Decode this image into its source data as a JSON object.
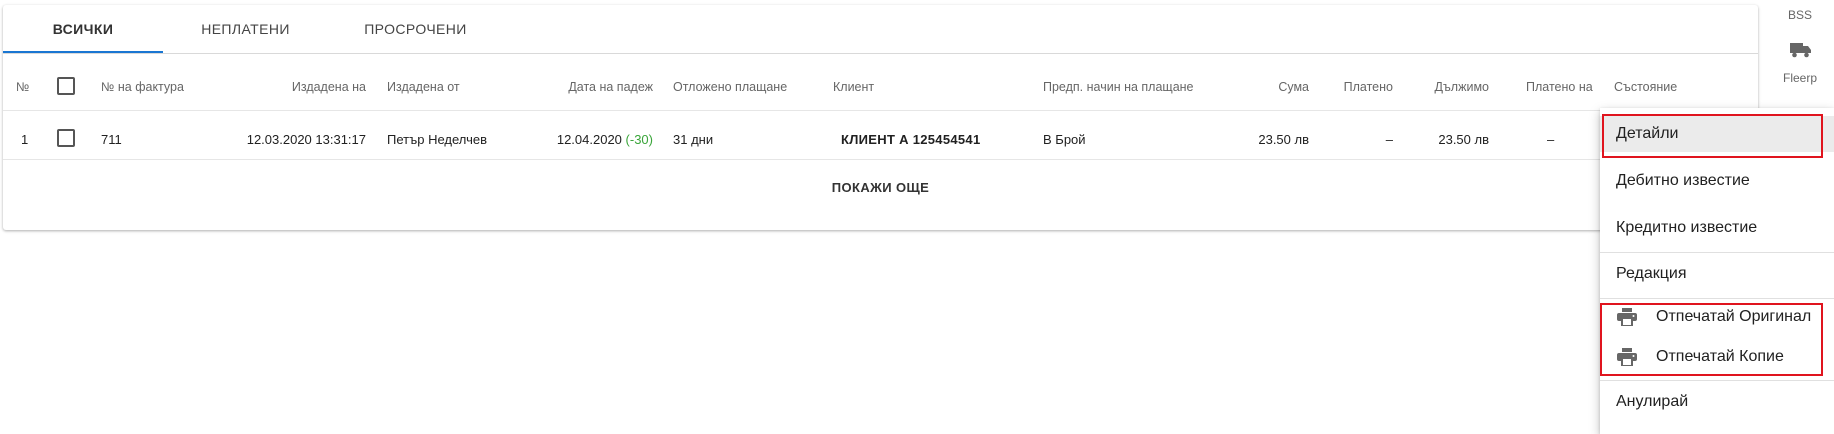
{
  "tabs": [
    {
      "label": "ВСИЧКИ",
      "active": true
    },
    {
      "label": "НЕПЛАТЕНИ",
      "active": false
    },
    {
      "label": "ПРОСРОЧЕНИ",
      "active": false
    }
  ],
  "table": {
    "headers": {
      "num": "№",
      "invoice_no": "№ на фактура",
      "issued_on": "Издадена на",
      "issued_by": "Издадена от",
      "due_date": "Дата на падеж",
      "deferred": "Отложено плащане",
      "client": "Клиент",
      "payment_method": "Предп. начин на плащане",
      "amount": "Сума",
      "paid": "Платено",
      "owed": "Дължимо",
      "paid_on": "Платено на",
      "status": "Състояние"
    },
    "rows": [
      {
        "num": "1",
        "invoice_no": "711",
        "issued_on": "12.03.2020 13:31:17",
        "issued_by": "Петър Неделчев",
        "due_date": "12.04.2020",
        "due_offset": "(-30)",
        "deferred": "31 дни",
        "client": "КЛИЕНТ А 125454541",
        "payment_method": "В Брой",
        "amount": "23.50 лв",
        "paid": "–",
        "owed": "23.50 лв",
        "paid_on": "–"
      }
    ],
    "show_more": "ПОКАЖИ ОЩЕ"
  },
  "rail": {
    "top_label": "BSS",
    "item_label": "Fleerp",
    "item_icon": "truck-icon"
  },
  "context_menu": {
    "items": [
      {
        "label": "Детайли",
        "highlighted": true
      },
      {
        "label": "Дебитно известие"
      },
      {
        "label": "Кредитно известие"
      },
      {
        "label": "Редакция"
      },
      {
        "label": "Отпечатай Оригинал",
        "icon": "print-icon"
      },
      {
        "label": "Отпечатай Копие",
        "icon": "print-icon"
      },
      {
        "label": "Анулирай"
      }
    ]
  },
  "colors": {
    "accent": "#1976d2",
    "positive": "#3aa53a",
    "highlight_box": "#e0141e"
  }
}
